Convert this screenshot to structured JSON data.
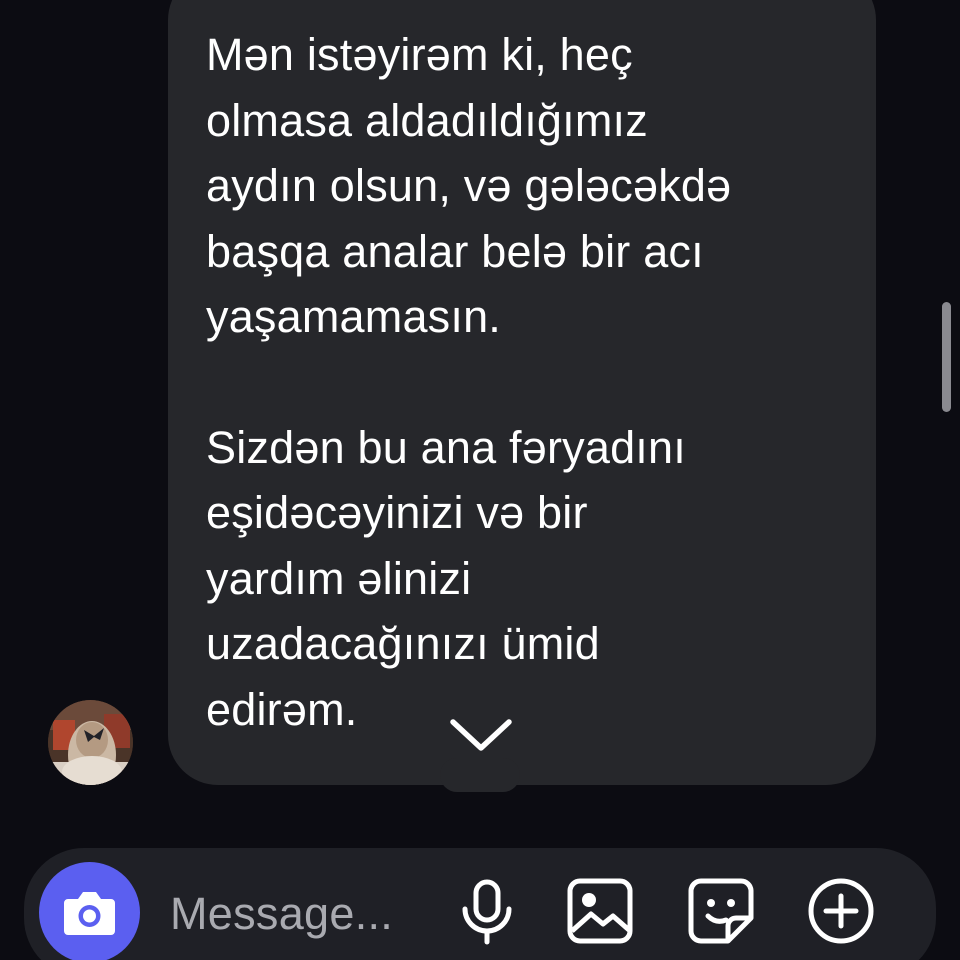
{
  "message": {
    "paragraph_1": [
      "Mən istəyirəm ki, heç",
      "olmasa aldadıldığımız",
      "aydın olsun, və gələcəkdə",
      "başqa analar belə bir acı",
      "yaşamamasın."
    ],
    "paragraph_2": [
      "Sizdən bu ana fəryadını",
      "eşidəcəyinizi və bir",
      "yardım əlinizi",
      "uzadacağınızı ümid",
      "edirəm."
    ]
  },
  "composer": {
    "placeholder": "Message..."
  },
  "icons": {
    "camera": "camera-icon",
    "mic": "microphone-icon",
    "gallery": "gallery-icon",
    "sticker": "sticker-icon",
    "add": "plus-circle-icon",
    "scroll_down": "chevron-down-icon"
  },
  "colors": {
    "background": "#0c0c12",
    "bubble": "#26272b",
    "composer": "#1f2026",
    "camera_button": "#5b5ff0",
    "placeholder_text": "#a9aab0"
  }
}
